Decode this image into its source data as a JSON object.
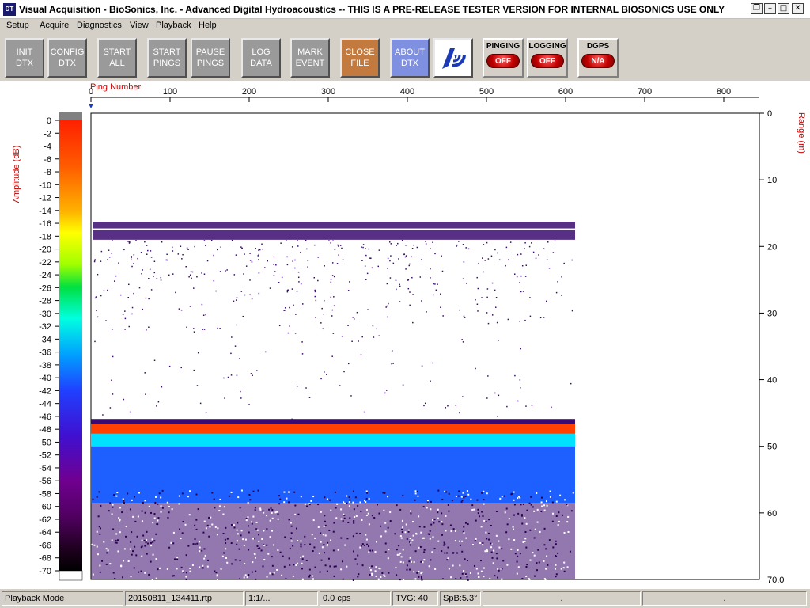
{
  "window": {
    "icon_text": "DT",
    "title": "Visual Acquisition  -  BioSonics, Inc.  -  Advanced Digital Hydroacoustics  -- THIS IS A PRE-RELEASE TESTER VERSION FOR INTERNAL BIOSONICS USE ONLY",
    "controls": [
      "❐",
      "–",
      "□",
      "✕"
    ]
  },
  "menu": [
    "Setup",
    "Acquire",
    "Diagnostics",
    "View",
    "Playback",
    "Help"
  ],
  "toolbar": {
    "buttons": [
      {
        "label1": "INIT",
        "label2": "DTX"
      },
      {
        "label1": "CONFIG",
        "label2": "DTX"
      },
      {
        "label1": "START",
        "label2": "ALL"
      },
      {
        "label1": "START",
        "label2": "PINGS"
      },
      {
        "label1": "PAUSE",
        "label2": "PINGS"
      },
      {
        "label1": "LOG",
        "label2": "DATA"
      },
      {
        "label1": "MARK",
        "label2": "EVENT"
      },
      {
        "label1": "CLOSE",
        "label2": "FILE"
      },
      {
        "label1": "ABOUT",
        "label2": "DTX"
      }
    ],
    "logo_icon": "biosonics-logo-icon",
    "indicators": [
      {
        "title": "PINGING",
        "state": "OFF"
      },
      {
        "title": "LOGGING",
        "state": "OFF"
      },
      {
        "title": "DGPS",
        "state": "N/A"
      }
    ]
  },
  "colors": {
    "axis_label": "#cc0000",
    "echo_low": "#3a0a6e",
    "echo_mid": "#1e60ff",
    "echo_high": "#00e0ff",
    "echo_peak": "#ff4000"
  },
  "chart_data": {
    "type": "heatmap",
    "x_axis": {
      "label": "Ping Number",
      "ticks": [
        0,
        100,
        200,
        300,
        400,
        500,
        600,
        700,
        800
      ],
      "range": [
        0,
        845
      ]
    },
    "y_axis": {
      "label": "Range (m)",
      "ticks": [
        0,
        10,
        20,
        30,
        40,
        50,
        60
      ],
      "end_label": "70.0",
      "range": [
        0,
        70
      ]
    },
    "color_scale": {
      "label": "Amplitude (dB)",
      "ticks": [
        0,
        -2,
        -4,
        -6,
        -8,
        -10,
        -12,
        -14,
        -16,
        -18,
        -20,
        -22,
        -24,
        -26,
        -28,
        -30,
        -32,
        -34,
        -36,
        -38,
        -40,
        -42,
        -44,
        -46,
        -48,
        -50,
        -52,
        -54,
        -56,
        -58,
        -60,
        -62,
        -64,
        -66,
        -68,
        -70
      ],
      "range": [
        0,
        -70
      ]
    },
    "pings_recorded": 612,
    "features": [
      {
        "range_m": 17.5,
        "type": "surface/layer band"
      },
      {
        "range_m": 47.5,
        "type": "bottom echo"
      }
    ]
  },
  "status": {
    "mode": "Playback Mode",
    "file": "20150811_134411.rtp",
    "ratio": "1:1/...",
    "rate": "0.0 cps",
    "tvg": "TVG: 40",
    "spb": "SpB:5.3°",
    "dot1": ".",
    "dot2": "."
  }
}
